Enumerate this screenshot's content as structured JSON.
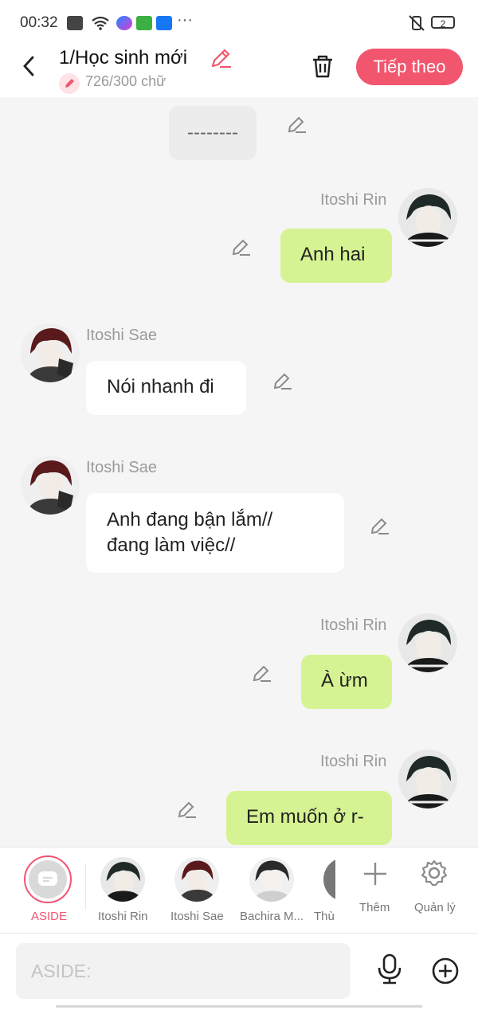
{
  "status_bar": {
    "time": "00:32",
    "battery": "2"
  },
  "header": {
    "title": "1/Học sinh mới",
    "word_count": "726/300 chữ",
    "next_label": "Tiếp theo"
  },
  "messages": [
    {
      "type": "aside",
      "text": "--------"
    },
    {
      "type": "right",
      "name": "Itoshi Rin",
      "text": "Anh hai"
    },
    {
      "type": "left",
      "name": "Itoshi Sae",
      "text": "Nói nhanh đi"
    },
    {
      "type": "left",
      "name": "Itoshi Sae",
      "line1": "Anh đang bận lắm//",
      "line2": "đang làm việc//"
    },
    {
      "type": "right",
      "name": "Itoshi Rin",
      "text": "À ừm"
    },
    {
      "type": "right",
      "name": "Itoshi Rin",
      "text": "Em muốn ở r-"
    }
  ],
  "cast": {
    "aside": "ASIDE",
    "items": [
      "Itoshi Rin",
      "Itoshi Sae",
      "Bachira M...",
      "Thù"
    ],
    "add": "Thêm",
    "manage": "Quản lý"
  },
  "input": {
    "placeholder": "ASIDE:"
  },
  "colors": {
    "accent": "#f2566e",
    "bubble_right": "#d5f392",
    "bubble_left": "#ffffff"
  }
}
